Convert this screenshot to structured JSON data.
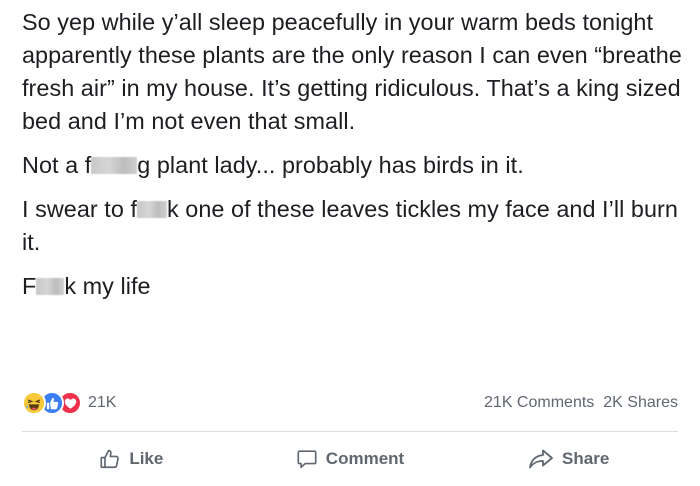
{
  "post": {
    "paragraph1": "So yep while y’all sleep peacefully in your warm beds tonight apparently these plants are the only reason I can even “breathe fresh air” in my house. It’s getting ridiculous. That’s a king sized bed and I’m not even that small.",
    "paragraph2": {
      "before": "Not a f",
      "after": "g plant lady... probably has birds in it."
    },
    "paragraph3": {
      "before": "I swear to f",
      "after": "k one of these leaves tickles my face and I’ll burn it."
    },
    "paragraph4": {
      "before": "F",
      "after": "k my life"
    }
  },
  "reactions": {
    "icons": [
      "haha-reaction-icon",
      "like-reaction-icon",
      "love-reaction-icon"
    ],
    "count": "21K",
    "colors": {
      "haha": "#f7c93b",
      "like": "#3b7ff5",
      "love": "#f0304a"
    }
  },
  "engagement": {
    "comments": "21K Comments",
    "shares": "2K Shares"
  },
  "actions": {
    "like_label": "Like",
    "comment_label": "Comment",
    "share_label": "Share"
  }
}
